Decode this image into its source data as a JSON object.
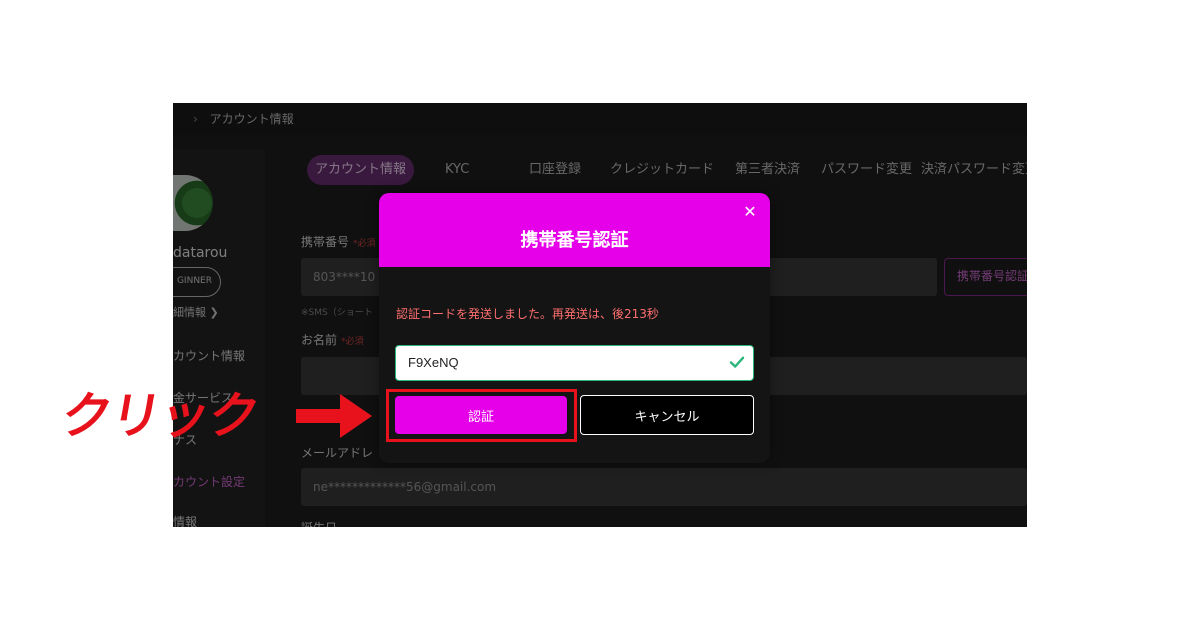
{
  "breadcrumb": {
    "separator": "›",
    "current": "アカウント情報"
  },
  "profile": {
    "username": "datarou",
    "rank": "GINNER",
    "detail_link": "細情報 ❯"
  },
  "sidebar": {
    "items": [
      {
        "label": "カウント情報",
        "active": false
      },
      {
        "label": "金サービス",
        "active": false
      },
      {
        "label": "ナス",
        "active": false
      },
      {
        "label": "カウント設定",
        "active": true
      },
      {
        "label": "情報",
        "active": false
      }
    ]
  },
  "tabs": [
    {
      "label": "アカウント情報",
      "active": true
    },
    {
      "label": "KYC",
      "active": false
    },
    {
      "label": "口座登録",
      "active": false
    },
    {
      "label": "クレジットカード",
      "active": false
    },
    {
      "label": "第三者決済",
      "active": false
    },
    {
      "label": "パスワード変更",
      "active": false
    },
    {
      "label": "決済パスワード変更",
      "active": false
    }
  ],
  "form": {
    "phone_label": "携帯番号",
    "phone_required": "*必須",
    "phone_value": "803****10",
    "sms_note": "※SMS（ショート",
    "phone_verify_button": "携帯番号認証",
    "name_label": "お名前",
    "name_required": "*必須",
    "email_label": "メールアドレ",
    "email_value": "ne*************56@gmail.com",
    "birth_label": "誕生日"
  },
  "modal": {
    "title": "携帯番号認証",
    "close_glyph": "✕",
    "message": "認証コードを発送しました。再発送は、後213秒",
    "code_value": "F9XeNQ",
    "verify_button": "認証",
    "cancel_button": "キャンセル"
  },
  "annotation": {
    "label": "クリック",
    "color": "#e8121d"
  },
  "colors": {
    "accent": "#e600ea",
    "success": "#29b57c",
    "error": "#ff6f6f"
  },
  "icons": {
    "check": "check-icon",
    "close": "close-icon",
    "arrow": "arrow-right-icon"
  }
}
